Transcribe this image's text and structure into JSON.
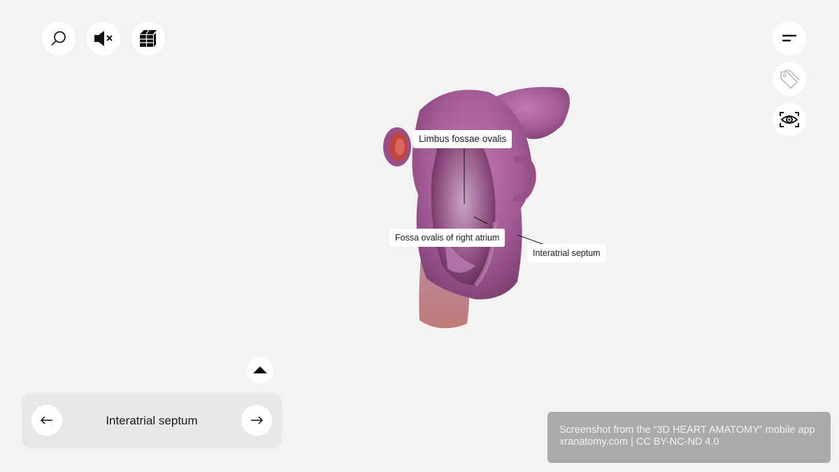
{
  "toolbar_left": {
    "search_icon": "search-icon",
    "mute_icon": "speaker-muted-icon",
    "layers_icon": "layers-cube-icon"
  },
  "toolbar_right": {
    "menu_icon": "menu-lines-icon",
    "tag_icon": "tag-icon",
    "view_icon": "eye-scan-icon"
  },
  "model": {
    "labels": {
      "limbus": "Limbus fossae ovalis",
      "fossa": "Fossa ovalis of right atrium",
      "septum": "Interatrial septum"
    }
  },
  "navigator": {
    "expand_icon": "caret-up-icon",
    "prev_icon": "arrow-left-icon",
    "next_icon": "arrow-right-icon",
    "title": "Interatrial septum"
  },
  "credit": {
    "line1": "Screenshot from the “3D HEART AMATOMY” mobile app",
    "line2": "xranatomy.com | CC BY-NC-ND 4.0"
  },
  "colors": {
    "background": "#f2f3f2",
    "button": "#ffffff",
    "panel": "#e8e8e8",
    "credit_bg": "#a9aaa9",
    "tissue": "#a45c97"
  }
}
